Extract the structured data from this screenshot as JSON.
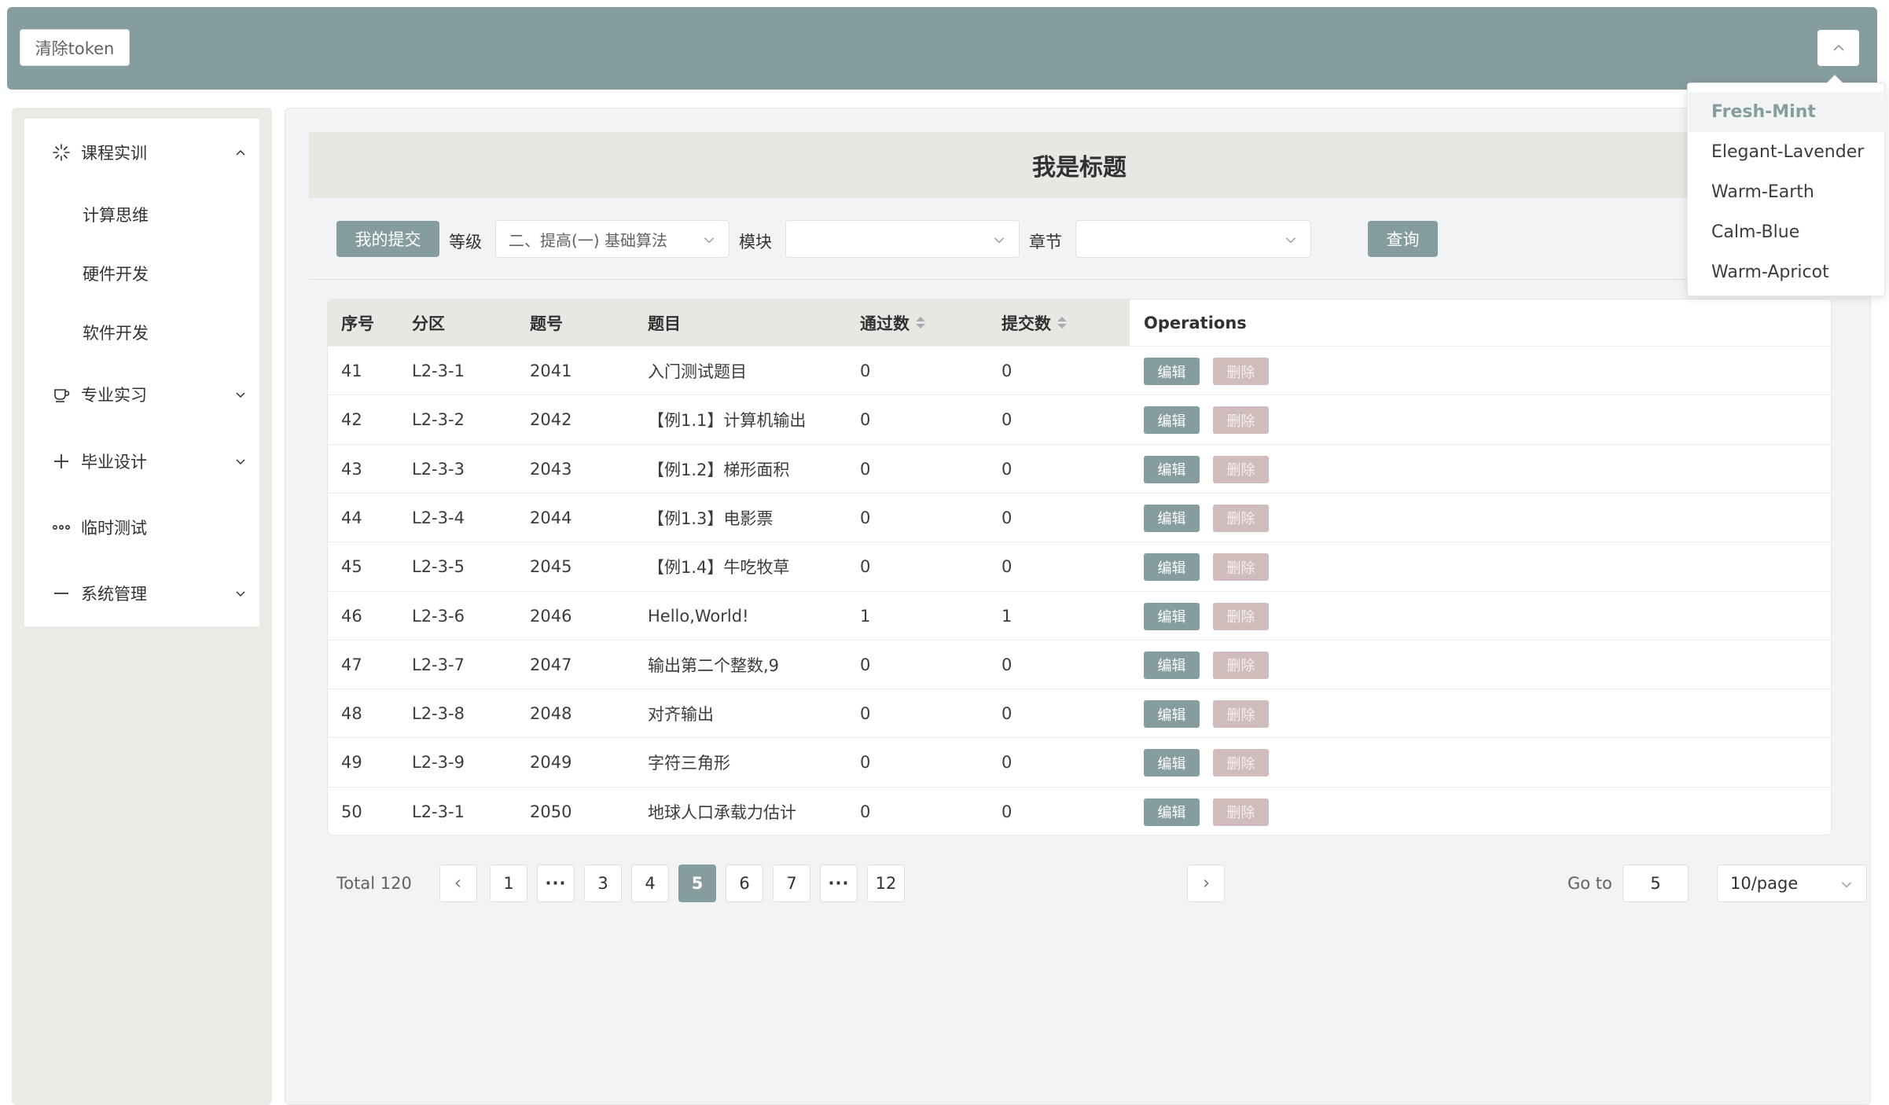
{
  "header": {
    "clear_token_label": "清除token"
  },
  "theme_menu": {
    "items": [
      "Fresh-Mint",
      "Elegant-Lavender",
      "Warm-Earth",
      "Calm-Blue",
      "Warm-Apricot"
    ],
    "active": "Fresh-Mint"
  },
  "sidebar": {
    "groups": [
      {
        "label": "课程实训",
        "icon": "loading-icon",
        "expanded": true,
        "children": [
          "计算思维",
          "硬件开发",
          "软件开发"
        ]
      },
      {
        "label": "专业实习",
        "icon": "coffee-cup-icon",
        "expanded": false
      },
      {
        "label": "毕业设计",
        "icon": "plus-icon",
        "expanded": false
      },
      {
        "label": "临时测试",
        "icon": "more-icon"
      },
      {
        "label": "系统管理",
        "icon": "minus-icon",
        "expanded": false
      }
    ]
  },
  "main": {
    "title": "我是标题",
    "filters": {
      "my_submit_label": "我的提交",
      "level_label": "等级",
      "level_value": "二、提高(一) 基础算法",
      "module_label": "模块",
      "module_value": "",
      "chapter_label": "章节",
      "chapter_value": "",
      "query_label": "查询"
    },
    "table": {
      "headers": [
        "序号",
        "分区",
        "题号",
        "题目",
        "通过数",
        "提交数",
        "Operations"
      ],
      "edit_label": "编辑",
      "delete_label": "删除",
      "rows": [
        [
          "41",
          "L2-3-1",
          "2041",
          "入门测试题目",
          "0",
          "0"
        ],
        [
          "42",
          "L2-3-2",
          "2042",
          "【例1.1】计算机输出",
          "0",
          "0"
        ],
        [
          "43",
          "L2-3-3",
          "2043",
          "【例1.2】梯形面积",
          "0",
          "0"
        ],
        [
          "44",
          "L2-3-4",
          "2044",
          "【例1.3】电影票",
          "0",
          "0"
        ],
        [
          "45",
          "L2-3-5",
          "2045",
          "【例1.4】牛吃牧草",
          "0",
          "0"
        ],
        [
          "46",
          "L2-3-6",
          "2046",
          "Hello,World!",
          "1",
          "1"
        ],
        [
          "47",
          "L2-3-7",
          "2047",
          "输出第二个整数,9",
          "0",
          "0"
        ],
        [
          "48",
          "L2-3-8",
          "2048",
          "对齐输出",
          "0",
          "0"
        ],
        [
          "49",
          "L2-3-9",
          "2049",
          "字符三角形",
          "0",
          "0"
        ],
        [
          "50",
          "L2-3-1",
          "2050",
          "地球人口承载力估计",
          "0",
          "0"
        ]
      ]
    },
    "pagination": {
      "total_label": "Total 120",
      "pages": [
        "1",
        "···",
        "3",
        "4",
        "5",
        "6",
        "7",
        "···",
        "12"
      ],
      "current": "5",
      "goto_label": "Go to",
      "goto_value": "5",
      "page_size": "10/page"
    }
  },
  "colors": {
    "primary": "#869d9f",
    "danger_plain": "#d0bcba",
    "table_header_bg": "#e8e8e3"
  }
}
